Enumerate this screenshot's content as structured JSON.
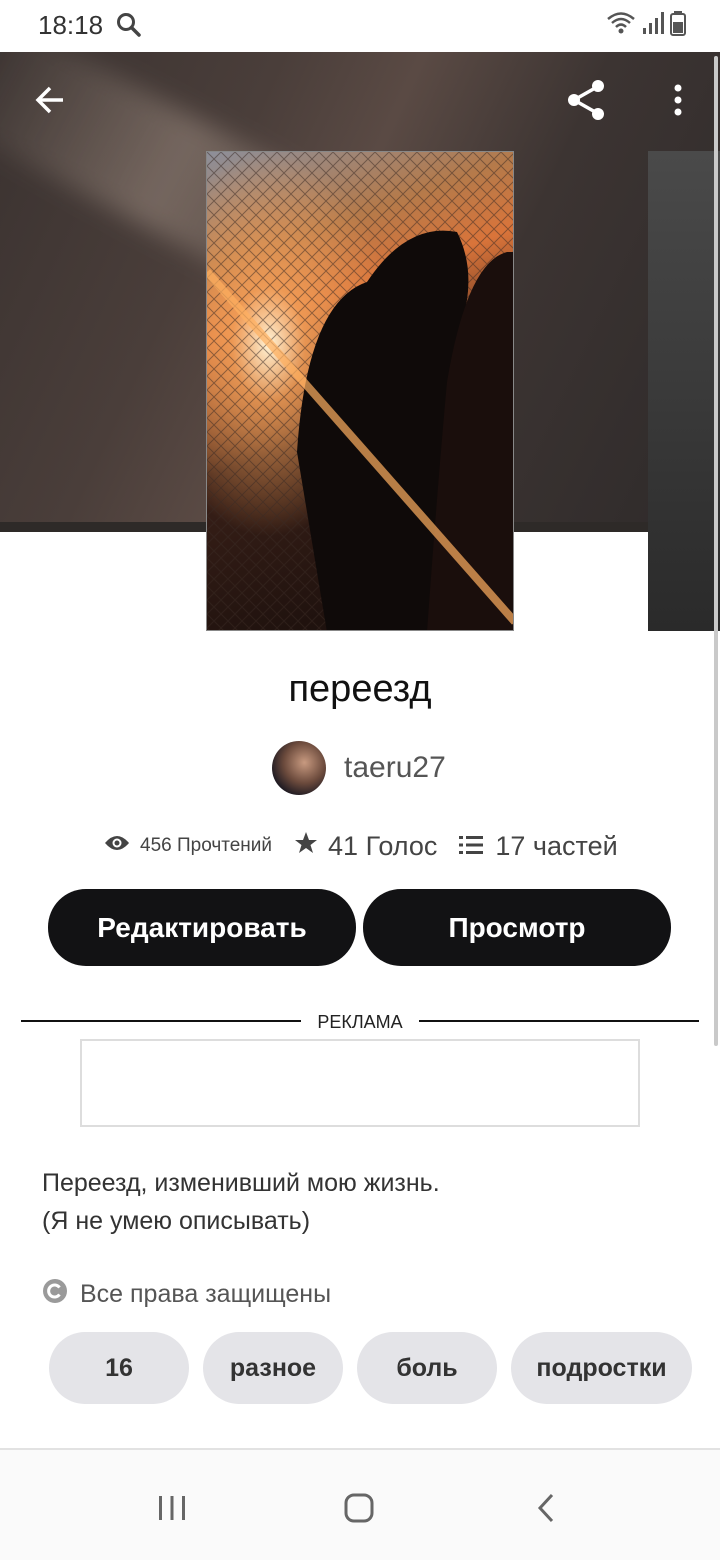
{
  "status_bar": {
    "time": "18:18"
  },
  "toolbar": {
    "back": "arrow-left-icon",
    "share": "share-icon",
    "more": "more-vert-icon"
  },
  "story": {
    "title": "переезд",
    "author": "taeru27",
    "stats": {
      "reads": "456 Прочтений",
      "votes": "41 Голос",
      "parts": "17 частей"
    },
    "buttons": {
      "edit": "Редактировать",
      "view": "Просмотр"
    },
    "ad_label": "РЕКЛАМА",
    "description": [
      "Переезд, изменивший мою жизнь.",
      "(Я не умею описывать)"
    ],
    "rights": "Все права защищены",
    "tags": [
      "16",
      "разное",
      "боль",
      "подростки"
    ]
  },
  "colors": {
    "button_bg": "#121214",
    "tag_bg": "#e4e4e8",
    "text_dark": "#111111",
    "text_muted": "#555555"
  }
}
